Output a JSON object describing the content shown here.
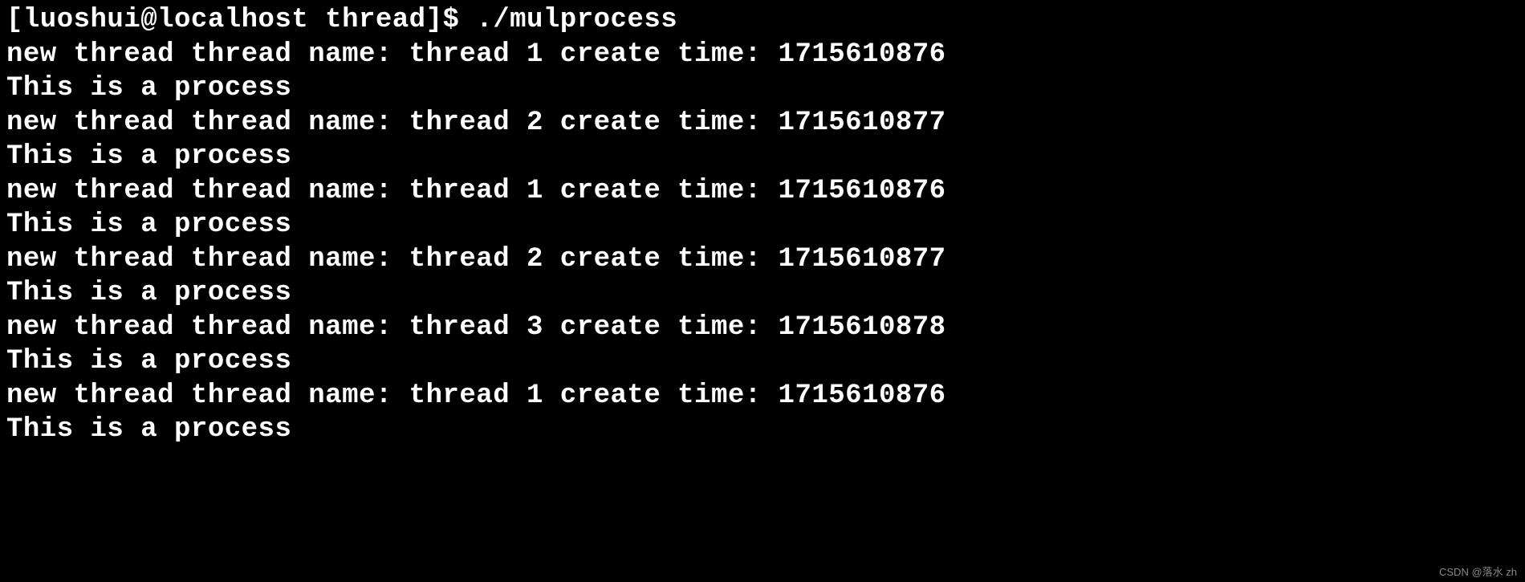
{
  "prompt": {
    "user": "luoshui",
    "host": "localhost",
    "cwd": "thread",
    "symbol": "$",
    "command": "./mulprocess"
  },
  "lines": [
    "[luoshui@localhost thread]$ ./mulprocess",
    "new thread thread name: thread 1 create time: 1715610876",
    "This is a process",
    "new thread thread name: thread 2 create time: 1715610877",
    "This is a process",
    "new thread thread name: thread 1 create time: 1715610876",
    "This is a process",
    "new thread thread name: thread 2 create time: 1715610877",
    "This is a process",
    "new thread thread name: thread 3 create time: 1715610878",
    "This is a process",
    "new thread thread name: thread 1 create time: 1715610876",
    "This is a process"
  ],
  "watermark": "CSDN @落水 zh"
}
